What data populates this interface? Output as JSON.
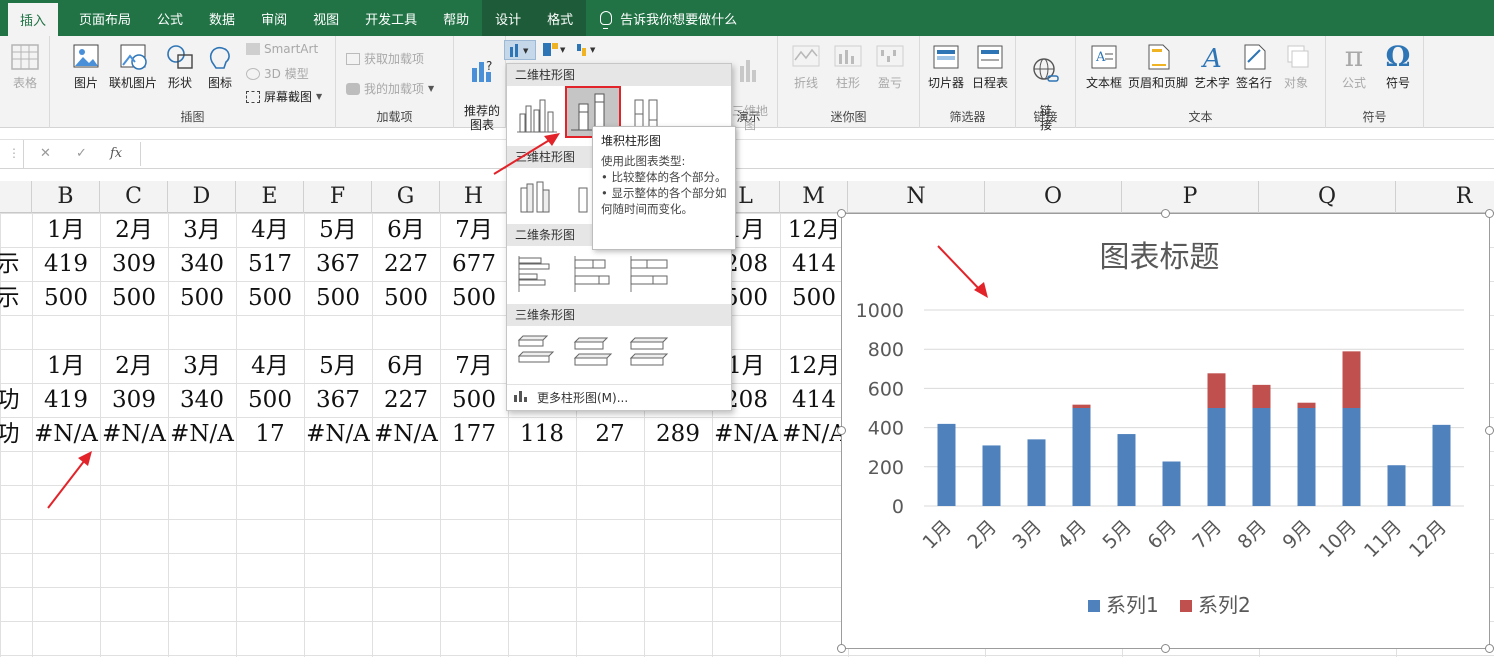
{
  "ribbon": {
    "tabs": [
      "插入",
      "页面布局",
      "公式",
      "数据",
      "审阅",
      "视图",
      "开发工具",
      "帮助",
      "设计",
      "格式"
    ],
    "active_tab": "插入",
    "tell_me": "告诉我你想要做什么",
    "groups": {
      "tables": {
        "label": "",
        "button": "表格"
      },
      "illustrations": {
        "label": "插图",
        "picture": "图片",
        "online_picture": "联机图片",
        "shapes": "形状",
        "icons": "图标",
        "smartart": "SmartArt",
        "model3d": "3D 模型",
        "screenshot": "屏幕截图"
      },
      "addins": {
        "label": "加载项",
        "get": "获取加载项",
        "my": "我的加载项"
      },
      "charts": {
        "recommended": "推荐的\n图表"
      },
      "tours": {
        "label": "演示",
        "map3d": "三维地\n图"
      },
      "sparklines": {
        "label": "迷你图",
        "line": "折线",
        "column": "柱形",
        "winloss": "盈亏"
      },
      "filters": {
        "label": "筛选器",
        "slicer": "切片器",
        "timeline": "日程表"
      },
      "links": {
        "label": "链接",
        "link": "链\n接"
      },
      "text": {
        "label": "文本",
        "textbox": "文本框",
        "header_footer": "页眉和页脚",
        "wordart": "艺术字",
        "signature": "签名行",
        "object": "对象"
      },
      "symbols": {
        "label": "符号",
        "equation": "公式",
        "symbol": "符号"
      }
    }
  },
  "formula_bar": {
    "cancel": "✕",
    "enter": "✓",
    "fx": "fx",
    "value": ""
  },
  "columns": [
    "B",
    "C",
    "D",
    "E",
    "F",
    "G",
    "H",
    "L",
    "M",
    "N",
    "O",
    "P",
    "Q",
    "R"
  ],
  "rows": [
    {
      "label": "",
      "cells": [
        "1月",
        "2月",
        "3月",
        "4月",
        "5月",
        "6月",
        "7月",
        "",
        "",
        "1月",
        "12月"
      ]
    },
    {
      "label": "示",
      "cells": [
        "419",
        "309",
        "340",
        "517",
        "367",
        "227",
        "677",
        "",
        "",
        "208",
        "414"
      ]
    },
    {
      "label": "示",
      "cells": [
        "500",
        "500",
        "500",
        "500",
        "500",
        "500",
        "500",
        "",
        "",
        "500",
        "500"
      ]
    },
    {
      "label": "",
      "cells": [
        "",
        "",
        "",
        "",
        "",
        "",
        "",
        "",
        "",
        "",
        ""
      ]
    },
    {
      "label": "",
      "cells": [
        "1月",
        "2月",
        "3月",
        "4月",
        "5月",
        "6月",
        "7月",
        "",
        "",
        "1月",
        "12月"
      ]
    },
    {
      "label": "功",
      "cells": [
        "419",
        "309",
        "340",
        "500",
        "367",
        "227",
        "500",
        "",
        "",
        "208",
        "414"
      ]
    },
    {
      "label": "功",
      "cells": [
        "#N/A",
        "#N/A",
        "#N/A",
        "17",
        "#N/A",
        "#N/A",
        "177",
        "118",
        "27",
        "289",
        "#N/A",
        "#N/A"
      ]
    }
  ],
  "dropdown": {
    "sections": [
      "二维柱形图",
      "三维柱形图",
      "二维条形图",
      "三维条形图"
    ],
    "more": "更多柱形图(M)..."
  },
  "tooltip": {
    "title": "堆积柱形图",
    "intro": "使用此图表类型:",
    "bullet1": "• 比较整体的各个部分。",
    "bullet2": "• 显示整体的各个部分如何随时间而变化。"
  },
  "colors": {
    "ribbon_green": "#217346",
    "series1": "#4f81bd",
    "series2": "#c0504d",
    "highlight": "#e2242a"
  },
  "chart_data": {
    "type": "bar",
    "stacked": true,
    "title": "图表标题",
    "categories": [
      "1月",
      "2月",
      "3月",
      "4月",
      "5月",
      "6月",
      "7月",
      "8月",
      "9月",
      "10月",
      "11月",
      "12月"
    ],
    "series": [
      {
        "name": "系列1",
        "values": [
          419,
          309,
          340,
          500,
          367,
          227,
          500,
          500,
          500,
          500,
          208,
          414
        ]
      },
      {
        "name": "系列2",
        "values": [
          0,
          0,
          0,
          17,
          0,
          0,
          177,
          118,
          27,
          289,
          0,
          0
        ]
      }
    ],
    "yticks": [
      "0",
      "200",
      "400",
      "600",
      "800",
      "1000"
    ],
    "ylim": [
      0,
      1000
    ],
    "grid": true,
    "legend": "bottom"
  }
}
